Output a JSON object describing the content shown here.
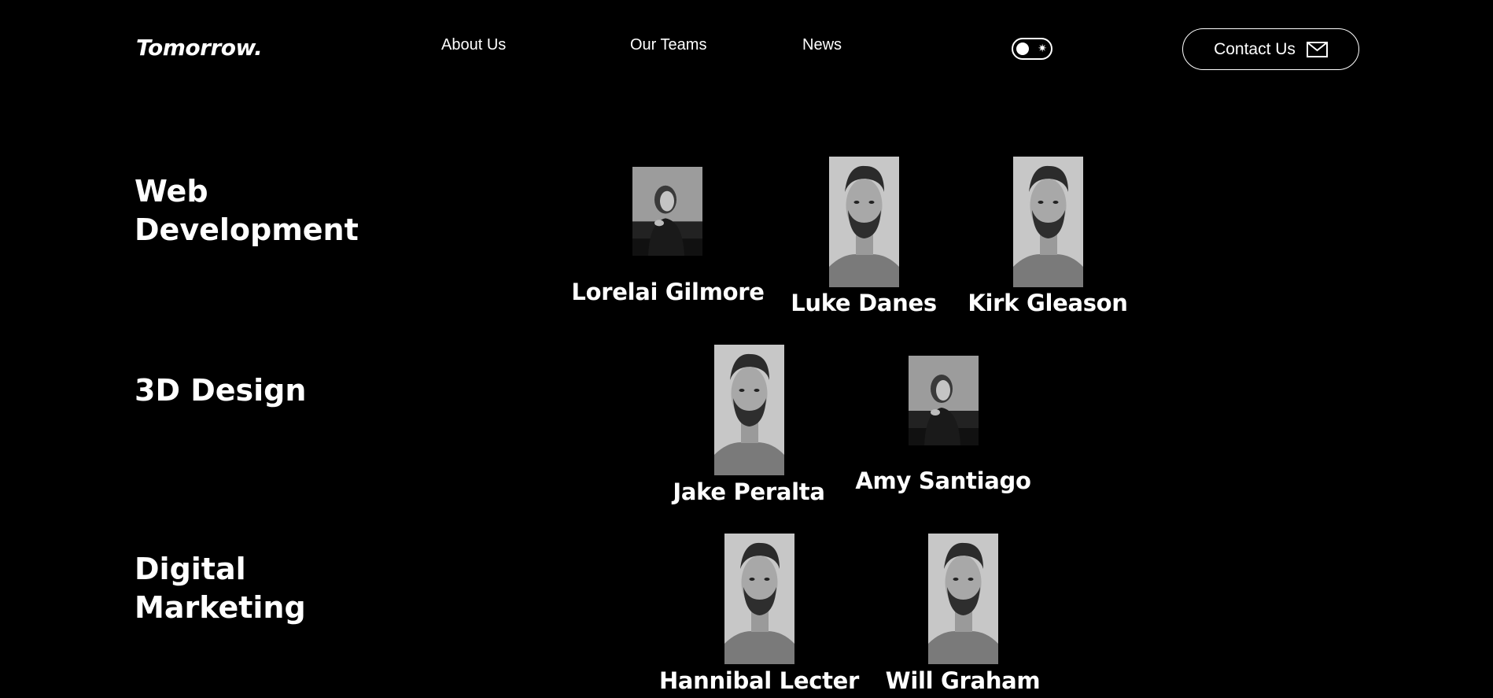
{
  "header": {
    "logo": "Tomorrow.",
    "nav": [
      "About Us",
      "Our Teams",
      "News"
    ],
    "contact_label": "Contact Us"
  },
  "sections": [
    {
      "title_lines": [
        "Web",
        "Development"
      ],
      "members": [
        {
          "name": "Lorelai Gilmore",
          "photo": "woman-portrait"
        },
        {
          "name": "Luke Danes",
          "photo": "man-portrait"
        },
        {
          "name": "Kirk Gleason",
          "photo": "man-portrait"
        }
      ]
    },
    {
      "title_lines": [
        "3D Design"
      ],
      "members": [
        {
          "name": "Jake Peralta",
          "photo": "man-portrait"
        },
        {
          "name": "Amy Santiago",
          "photo": "woman-portrait"
        }
      ]
    },
    {
      "title_lines": [
        "Digital",
        "Marketing"
      ],
      "members": [
        {
          "name": "Hannibal Lecter",
          "photo": "man-portrait"
        },
        {
          "name": "Will Graham",
          "photo": "man-portrait"
        }
      ]
    }
  ],
  "colors": {
    "background": "#000000",
    "text": "#ffffff"
  }
}
